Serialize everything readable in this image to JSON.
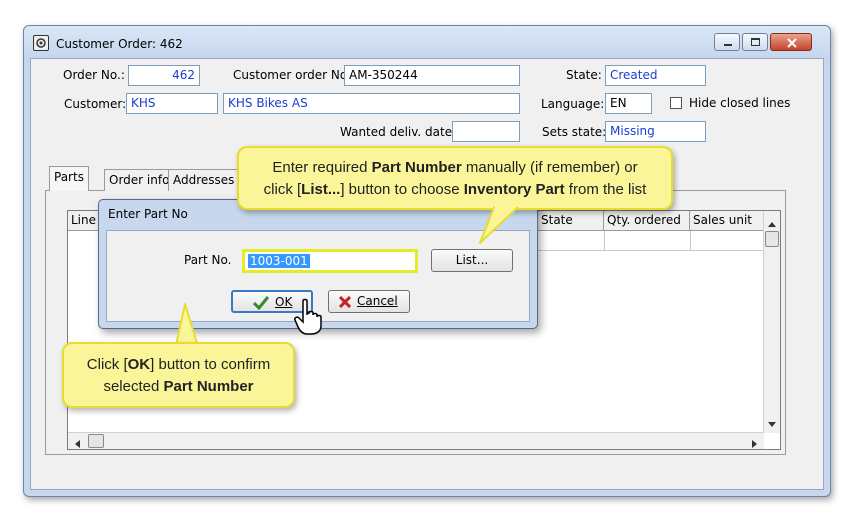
{
  "window": {
    "title": "Customer Order: 462"
  },
  "header": {
    "order_no_label": "Order No.:",
    "order_no_value": "462",
    "customer_order_no_label": "Customer order No.:",
    "customer_order_no_value": "AM-350244",
    "state_label": "State:",
    "state_value": "Created",
    "customer_label": "Customer:",
    "customer_code": "KHS",
    "customer_name": "KHS Bikes AS",
    "language_label": "Language:",
    "language_value": "EN",
    "hide_closed_label": "Hide closed lines",
    "wanted_date_label": "Wanted deliv. date:",
    "wanted_date_value": "",
    "sets_state_label": "Sets state:",
    "sets_state_value": "Missing"
  },
  "tabs": [
    {
      "label": "Parts"
    },
    {
      "label": "Order info"
    },
    {
      "label": "Addresses"
    }
  ],
  "grid": {
    "columns": [
      "Line",
      "State",
      "Qty. ordered",
      "Sales unit"
    ]
  },
  "dialog": {
    "title": "Enter Part No",
    "part_no_label": "Part No.",
    "part_no_value": "1003-001",
    "list_label": "List...",
    "ok_label": "OK",
    "cancel_label": "Cancel"
  },
  "callouts": {
    "top_line1_pre": "Enter required ",
    "top_line1_bold": "Part Number",
    "top_line1_post": " manually (if remember) or",
    "top_line2_pre": "click [",
    "top_line2_bold1": "List...",
    "top_line2_mid": "] button to choose ",
    "top_line2_bold2": "Inventory Part",
    "top_line2_post": " from the list",
    "bottom_line1_pre": "Click [",
    "bottom_line1_bold": "OK",
    "bottom_line1_post": "] button to confirm",
    "bottom_line2_pre": "selected ",
    "bottom_line2_bold": "Part Number"
  },
  "colors": {
    "callout_bg": "#fbf59a",
    "link_text": "#1a3ed1",
    "selection": "#3399ff"
  }
}
